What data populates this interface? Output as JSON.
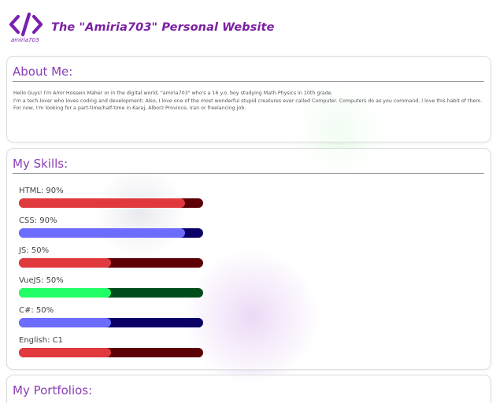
{
  "header": {
    "logo_caption": "amiria703",
    "title": "The \"Amiria703\" Personal Website"
  },
  "about": {
    "title": "About Me:",
    "paragraphs": [
      "Hello Guys! I'm Amir Hossein Maher or in the digital world, \"amiria703\" who's a 16 y.o. boy studying Math-Physics in 10th grade.",
      "I'm a tech-lover who loves coding and development; Also, I love one of the most wonderful stupid creatures ever called Computer. Computers do as you command, I love this habit of them.",
      "For now, I'm looking for a part-time/half-time in Karaj, Alborz Province, Iran or freelancing job."
    ]
  },
  "skills": {
    "title": "My Skills:",
    "items": [
      {
        "label": "HTML: 90%",
        "level": 0.9,
        "fill": "#e0393e",
        "track": "#5c0006"
      },
      {
        "label": "CSS: 90%",
        "level": 0.9,
        "fill": "#6c6cff",
        "track": "#0b0066"
      },
      {
        "label": "JS: 50%",
        "level": 0.5,
        "fill": "#e0393e",
        "track": "#5c0006"
      },
      {
        "label": "VueJS: 50%",
        "level": 0.5,
        "fill": "#22ff66",
        "track": "#004d1a"
      },
      {
        "label": "C#: 50%",
        "level": 0.5,
        "fill": "#6c6cff",
        "track": "#0b0066"
      },
      {
        "label": "English: C1",
        "level": 0.5,
        "fill": "#e0393e",
        "track": "#5c0006"
      }
    ]
  },
  "portfolios": {
    "title": "My Portfolios:"
  },
  "colors": {
    "accent": "#7b1fa2"
  }
}
